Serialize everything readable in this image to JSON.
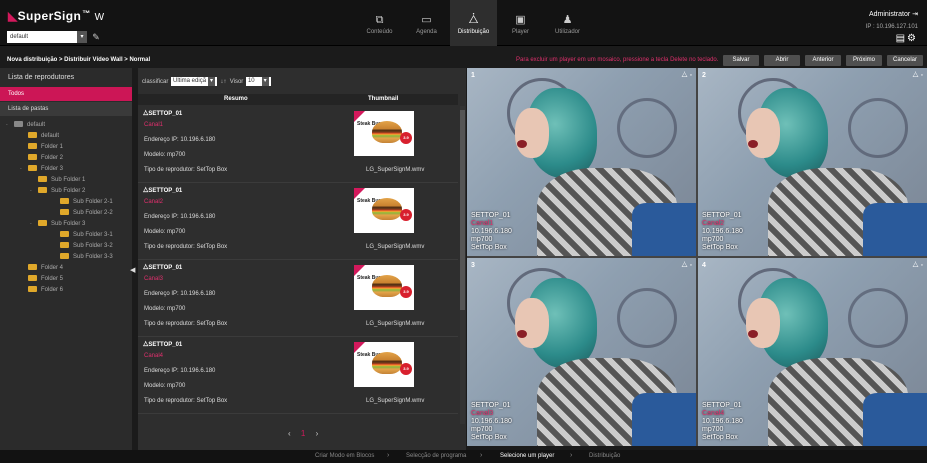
{
  "app": {
    "logo": "SuperSign",
    "logo_suffix": "W",
    "logo_sup": "™"
  },
  "group_select": "default",
  "nav": [
    {
      "label": "Conteúdo",
      "icon": "content-icon",
      "glyph": "⧉"
    },
    {
      "label": "Agenda",
      "icon": "calendar-icon",
      "glyph": "▭"
    },
    {
      "label": "Distribuição",
      "icon": "distribution-icon",
      "glyph": "⧊"
    },
    {
      "label": "Player",
      "icon": "player-icon",
      "glyph": "▣"
    },
    {
      "label": "Utilizador",
      "icon": "user-icon",
      "glyph": "♟"
    }
  ],
  "user": {
    "name": "Administrator",
    "ip": "IP : 10.196.127.101"
  },
  "breadcrumb": "Nova distribuição > Distribuir Vídeo Wall > Normal",
  "hint": "Para excluir um player em um mosaico, pressione a tecla Delete no teclado.",
  "actions": {
    "save": "Salvar",
    "open": "Abrir",
    "prev": "Anterior",
    "next": "Próximo",
    "cancel": "Cancelar"
  },
  "left": {
    "title": "Lista de reprodutores",
    "all": "Todos",
    "folders_list": "Lista de pastas",
    "tree": [
      {
        "label": "default",
        "depth": 0,
        "toggle": "-",
        "grey": true
      },
      {
        "label": "default",
        "depth": 1
      },
      {
        "label": "Folder 1",
        "depth": 1
      },
      {
        "label": "Folder 2",
        "depth": 1
      },
      {
        "label": "Folder 3",
        "depth": 1,
        "toggle": "-"
      },
      {
        "label": "Sub Folder 1",
        "depth": 2
      },
      {
        "label": "Sub Folder 2",
        "depth": 2,
        "toggle": "-"
      },
      {
        "label": "Sub Folder 2-1",
        "depth": 3
      },
      {
        "label": "Sub Folder 2-2",
        "depth": 3
      },
      {
        "label": "Sub Folder 3",
        "depth": 2,
        "toggle": "-"
      },
      {
        "label": "Sub Folder 3-1",
        "depth": 3
      },
      {
        "label": "Sub Folder 3-2",
        "depth": 3
      },
      {
        "label": "Sub Folder 3-3",
        "depth": 3
      },
      {
        "label": "Folder 4",
        "depth": 1
      },
      {
        "label": "Folder 5",
        "depth": 1
      },
      {
        "label": "Folder 6",
        "depth": 1
      }
    ]
  },
  "toolbar": {
    "sort_label": "classificar",
    "sort_value": "Última ediçã",
    "view_label": "Visor",
    "view_value": "10"
  },
  "table": {
    "col_summary": "Resumo",
    "col_thumb": "Thumbnail"
  },
  "players": [
    {
      "name": "SETTOP_01",
      "channel": "Canal1",
      "ip": "Endereço IP: 10.196.6.180",
      "model": "Modelo: mp700",
      "type": "Tipo de reprodutor: SetTop Box",
      "file": "LG_SuperSignM.wmv"
    },
    {
      "name": "SETTOP_01",
      "channel": "Canal2",
      "ip": "Endereço IP: 10.196.6.180",
      "model": "Modelo: mp700",
      "type": "Tipo de reprodutor: SetTop Box",
      "file": "LG_SuperSignM.wmv"
    },
    {
      "name": "SETTOP_01",
      "channel": "Canal3",
      "ip": "Endereço IP: 10.196.6.180",
      "model": "Modelo: mp700",
      "type": "Tipo de reprodutor: SetTop Box",
      "file": "LG_SuperSignM.wmv"
    },
    {
      "name": "SETTOP_01",
      "channel": "Canal4",
      "ip": "Endereço IP: 10.196.6.180",
      "model": "Modelo: mp700",
      "type": "Tipo de reprodutor: SetTop Box",
      "file": "LG_SuperSignM.wmv"
    }
  ],
  "thumb_text": "Steak Burger",
  "thumb_badge": "3.9",
  "pager": {
    "prev": "‹",
    "current": "1",
    "next": "›"
  },
  "tiles": [
    {
      "num": "1",
      "name": "SETTOP_01",
      "channel": "Canal1",
      "ip": "10.196.6.180",
      "model": "mp700",
      "type": "SetTop Box"
    },
    {
      "num": "2",
      "name": "SETTOP_01",
      "channel": "Canal2",
      "ip": "10.196.6.180",
      "model": "mp700",
      "type": "SetTop Box"
    },
    {
      "num": "3",
      "name": "SETTOP_01",
      "channel": "Canal3",
      "ip": "10.196.6.180",
      "model": "mp700",
      "type": "SetTop Box"
    },
    {
      "num": "4",
      "name": "SETTOP_01",
      "channel": "Canal4",
      "ip": "10.196.6.180",
      "model": "mp700",
      "type": "SetTop Box"
    }
  ],
  "steps": [
    "Criar Modo em Blocos",
    "Selecção de programa",
    "Selecione um player",
    "Distribuição"
  ],
  "colors": {
    "accent": "#cc1656",
    "hint": "#e0306d",
    "folder": "#e0a82a"
  }
}
